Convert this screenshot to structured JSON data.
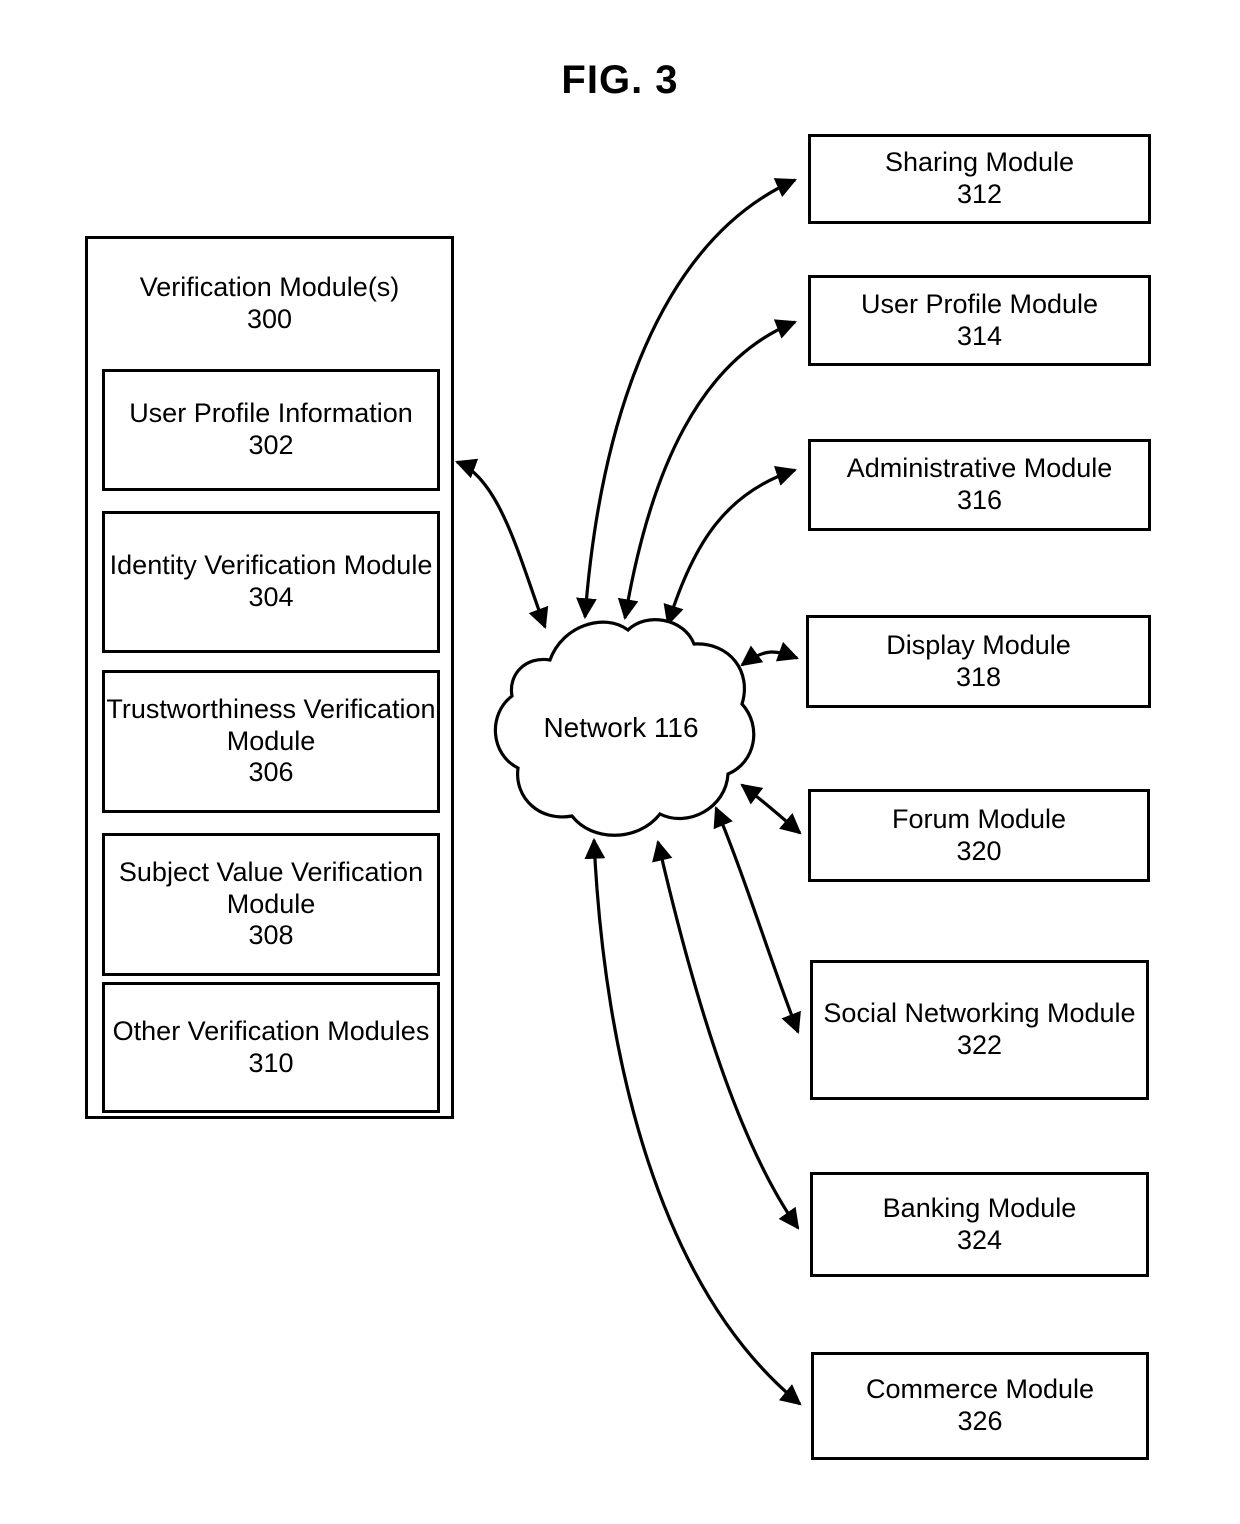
{
  "figure": {
    "title": "FIG. 3"
  },
  "verification_container": {
    "title": "Verification Module(s)",
    "number": "300",
    "modules": [
      {
        "label": "User Profile Information",
        "number": "302"
      },
      {
        "label": "Identity Verification Module",
        "number": "304"
      },
      {
        "label": "Trustworthiness Verification Module",
        "number": "306"
      },
      {
        "label": "Subject Value Verification Module",
        "number": "308"
      },
      {
        "label": "Other Verification Modules",
        "number": "310"
      }
    ]
  },
  "network": {
    "label": "Network 116"
  },
  "right_modules": [
    {
      "label": "Sharing Module",
      "number": "312"
    },
    {
      "label": "User Profile Module",
      "number": "314"
    },
    {
      "label": "Administrative Module",
      "number": "316"
    },
    {
      "label": "Display Module",
      "number": "318"
    },
    {
      "label": "Forum Module",
      "number": "320"
    },
    {
      "label": "Social Networking Module",
      "number": "322"
    },
    {
      "label": "Banking Module",
      "number": "324"
    },
    {
      "label": "Commerce Module",
      "number": "326"
    }
  ],
  "colors": {
    "stroke": "#000000",
    "background": "#ffffff"
  }
}
